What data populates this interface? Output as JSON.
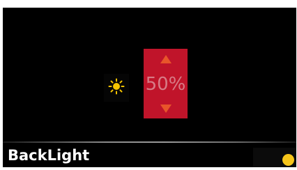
{
  "screen": {
    "title": "BackLight",
    "brightness": {
      "value_text": "50%",
      "value": 50,
      "increase_icon": "triangle-up-icon",
      "decrease_icon": "triangle-down-icon",
      "color": "#c0142a"
    },
    "brightness_icon": "sun-icon",
    "status_dot_color": "#f7c51a"
  }
}
